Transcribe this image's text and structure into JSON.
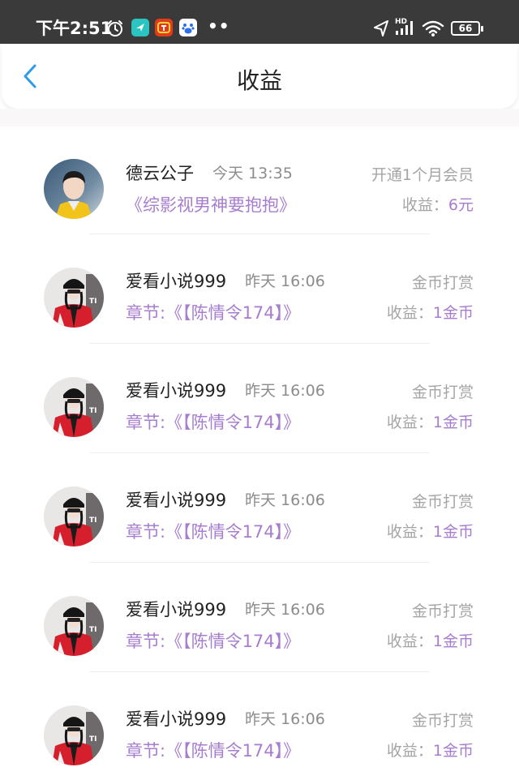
{
  "status_bar": {
    "time": "下午2:51",
    "more": "••",
    "network": "HD",
    "battery": "66"
  },
  "header": {
    "title": "收益"
  },
  "colors": {
    "accent_purple": "#a77dcf",
    "back_blue": "#2f9be8",
    "status_bar_bg": "#3a3a3a"
  },
  "earnings": [
    {
      "name": "德云公子",
      "time": "今天 13:35",
      "source": "《综影视男神要抱抱》",
      "type": "开通1个月会员",
      "earn_label": "收益：",
      "earn_value": "6元",
      "avatar": "avatar-1"
    },
    {
      "name": "爱看小说999",
      "time": "昨天 16:06",
      "source": "章节:《【陈情令174】》",
      "type": "金币打赏",
      "earn_label": "收益：",
      "earn_value": "1金币",
      "avatar": "avatar-2"
    },
    {
      "name": "爱看小说999",
      "time": "昨天 16:06",
      "source": "章节:《【陈情令174】》",
      "type": "金币打赏",
      "earn_label": "收益：",
      "earn_value": "1金币",
      "avatar": "avatar-2"
    },
    {
      "name": "爱看小说999",
      "time": "昨天 16:06",
      "source": "章节:《【陈情令174】》",
      "type": "金币打赏",
      "earn_label": "收益：",
      "earn_value": "1金币",
      "avatar": "avatar-2"
    },
    {
      "name": "爱看小说999",
      "time": "昨天 16:06",
      "source": "章节:《【陈情令174】》",
      "type": "金币打赏",
      "earn_label": "收益：",
      "earn_value": "1金币",
      "avatar": "avatar-2"
    },
    {
      "name": "爱看小说999",
      "time": "昨天 16:06",
      "source": "章节:《【陈情令174】》",
      "type": "金币打赏",
      "earn_label": "收益：",
      "earn_value": "1金币",
      "avatar": "avatar-2"
    }
  ]
}
